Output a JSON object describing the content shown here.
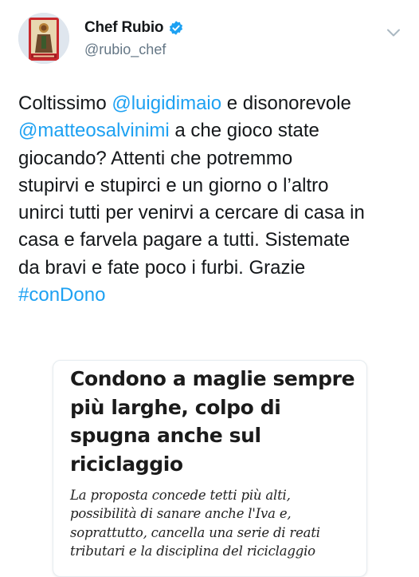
{
  "author": {
    "display_name": "Chef Rubio",
    "handle": "@rubio_chef",
    "avatar_icon": "religious-icon-avatar",
    "verified_icon": "verified-badge-icon",
    "verified_color": "#1da1f2"
  },
  "menu": {
    "icon": "chevron-down-icon"
  },
  "tweet": {
    "link_color": "#1da1f2",
    "segments": [
      {
        "type": "text",
        "text": "Coltissimo "
      },
      {
        "type": "mention",
        "text": "@luigidimaio"
      },
      {
        "type": "text",
        "text": " e disonorevole\n"
      },
      {
        "type": "mention",
        "text": "@matteosalvinimi"
      },
      {
        "type": "text",
        "text": " a che gioco state\ngiocando? Attenti che potremmo\nstupirvi e stupirci e un giorno o l’altro\nunirci tutti per venirvi a cercare di casa in\ncasa e farvela pagare a tutti. Sistemate\nda bravi e fate poco i furbi. Grazie\n"
      },
      {
        "type": "hashtag",
        "text": "#conDono"
      }
    ]
  },
  "card": {
    "title": "Condono a maglie sempre più larghe, colpo di spugna anche sul riciclaggio",
    "description": "La proposta concede tetti più alti, possibilità di sanare anche l'Iva e, soprattutto, cancella una serie di reati tributari e la disciplina del riciclaggio"
  }
}
